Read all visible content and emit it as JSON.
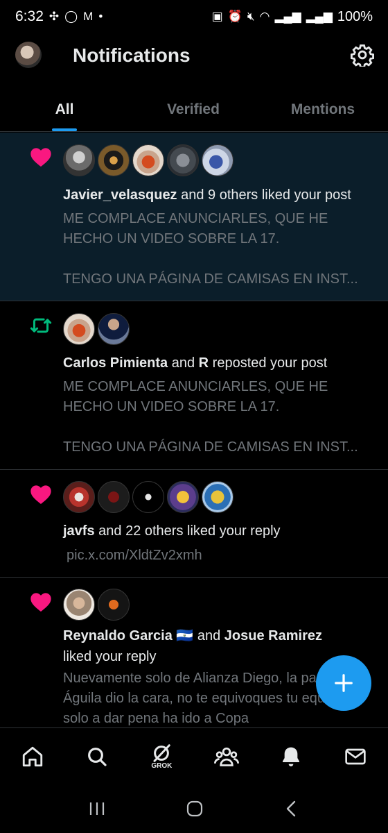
{
  "status_bar": {
    "time": "6:32",
    "battery": "100%"
  },
  "header": {
    "title": "Notifications"
  },
  "tabs": [
    {
      "label": "All",
      "active": true
    },
    {
      "label": "Verified",
      "active": false
    },
    {
      "label": "Mentions",
      "active": false
    }
  ],
  "notifications": [
    {
      "type": "like",
      "actor": "Javier_velasquez",
      "action": " and 9 others liked your post",
      "preview": "ME COMPLACE ANUNCIARLES, QUE HE HECHO UN VIDEO SOBRE LA 17.\n\nTENGO UNA PÁGINA DE CAMISAS EN INST..."
    },
    {
      "type": "repost",
      "actor": "Carlos Pimienta",
      "mid": " and ",
      "actor2": "R",
      "action": " reposted your post",
      "preview": "ME COMPLACE ANUNCIARLES, QUE HE HECHO UN VIDEO SOBRE LA 17.\n\nTENGO UNA PÁGINA DE CAMISAS EN INST..."
    },
    {
      "type": "like",
      "actor": "javfs",
      "action": " and 22 others liked your reply",
      "preview": "pic.x.com/XldtZv2xmh"
    },
    {
      "type": "like",
      "actor": "Reynaldo Garcia 🇸🇻",
      "mid": " and ",
      "actor2": "Josue Ramirez",
      "action": " liked your reply",
      "preview": "Nuevamente solo de Alianza Diego, la pasada Águila dio la cara, no te equivoques tu equipito solo a dar pena ha ido a Copa"
    }
  ],
  "bottom_nav": {
    "grok_label": "GROK",
    "icons": [
      "home-icon",
      "search-icon",
      "grok-icon",
      "communities-icon",
      "notifications-icon",
      "messages-icon"
    ]
  },
  "colors": {
    "accent": "#1d9bf0",
    "like": "#f91880",
    "repost": "#00ba7c",
    "unread_bg": "#0b1e2a"
  }
}
